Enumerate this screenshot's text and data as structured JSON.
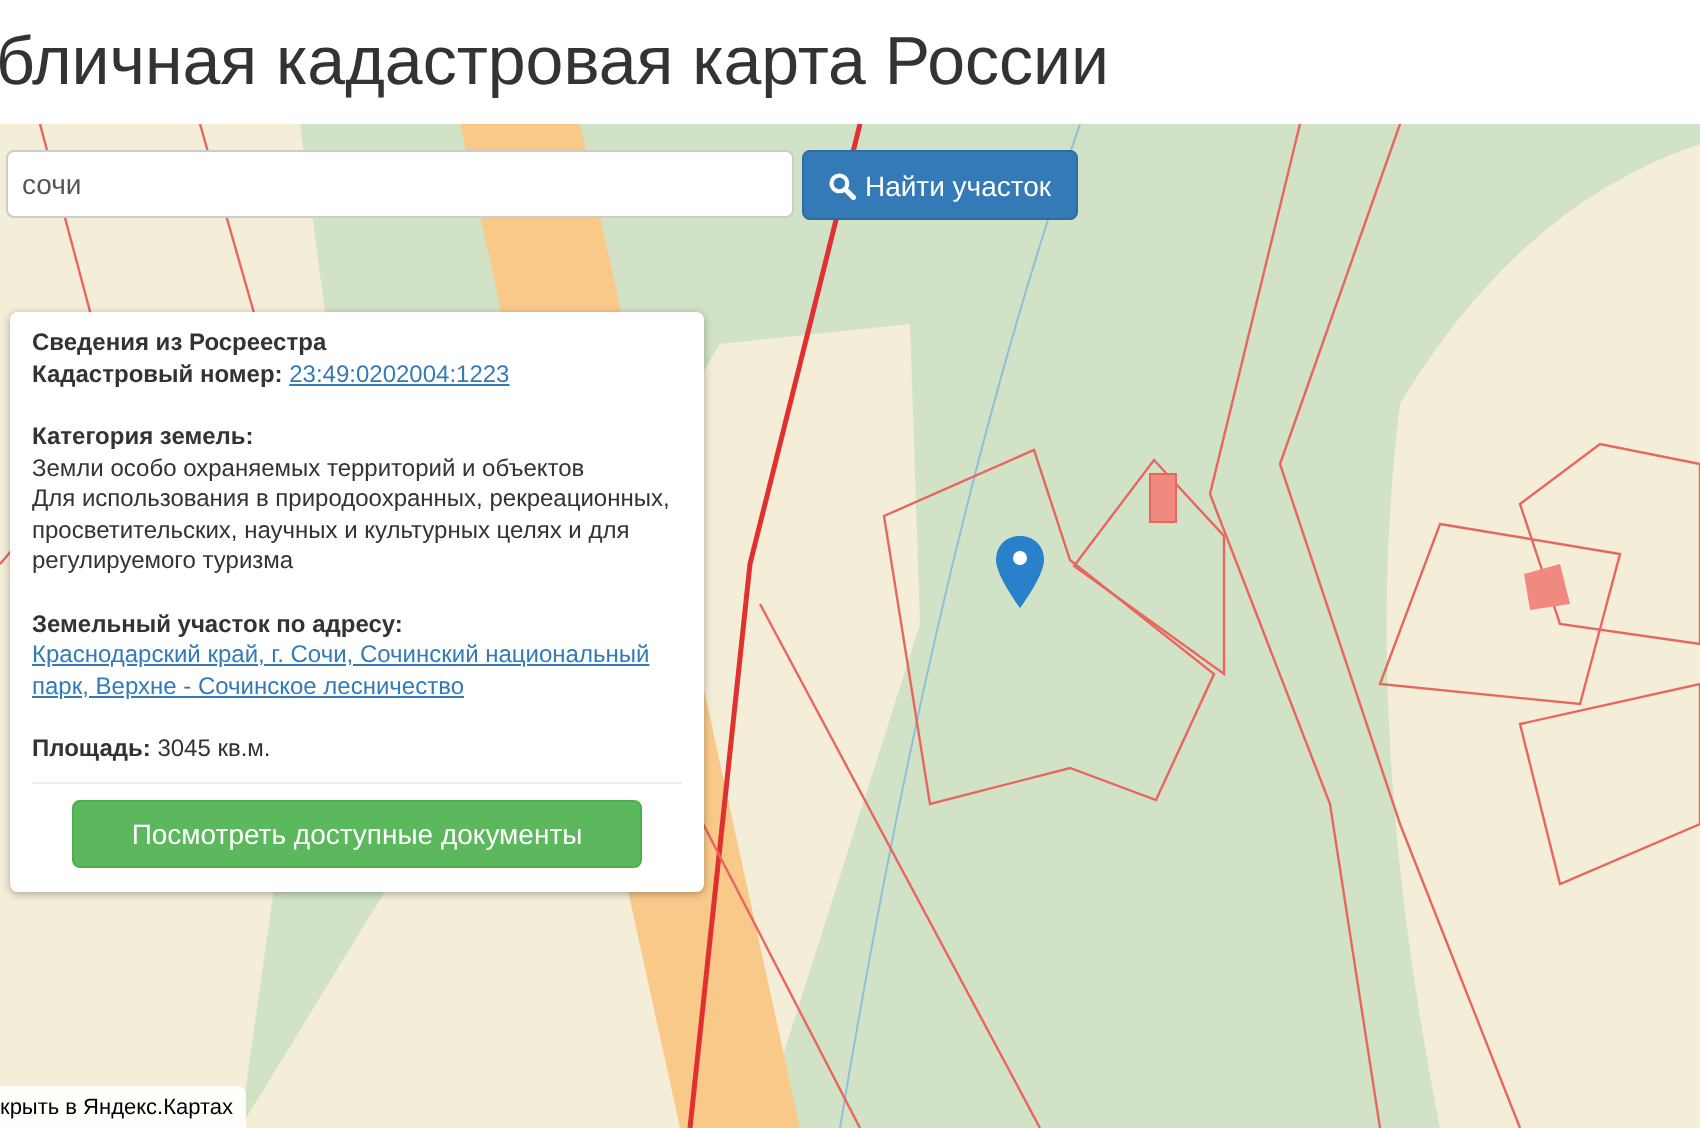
{
  "page_title": "бличная кадастровая карта России",
  "search": {
    "value": "сочи",
    "button": "Найти участок"
  },
  "info_card": {
    "title": "Сведения из Росреестра",
    "cadastral_number": {
      "label": "Кадастровый номер:",
      "value": "23:49:0202004:1223"
    },
    "land_category": {
      "label": "Категория земель:",
      "lines": [
        "Земли особо охраняемых территорий и объектов",
        "Для использования в природоохранных, рекреационных, просветительских, научных и культурных целях и для регулируемого туризма"
      ]
    },
    "address": {
      "label": "Земельный участок по адресу:",
      "value": "Краснодарский край, г. Сочи, Сочинский национальный парк, Верхне - Сочинское лесничество"
    },
    "area": {
      "label": "Площадь:",
      "value": "3045 кв.м."
    },
    "button": "Посмотреть доступные документы"
  },
  "map_link": "крыть в Яндекс.Картах"
}
